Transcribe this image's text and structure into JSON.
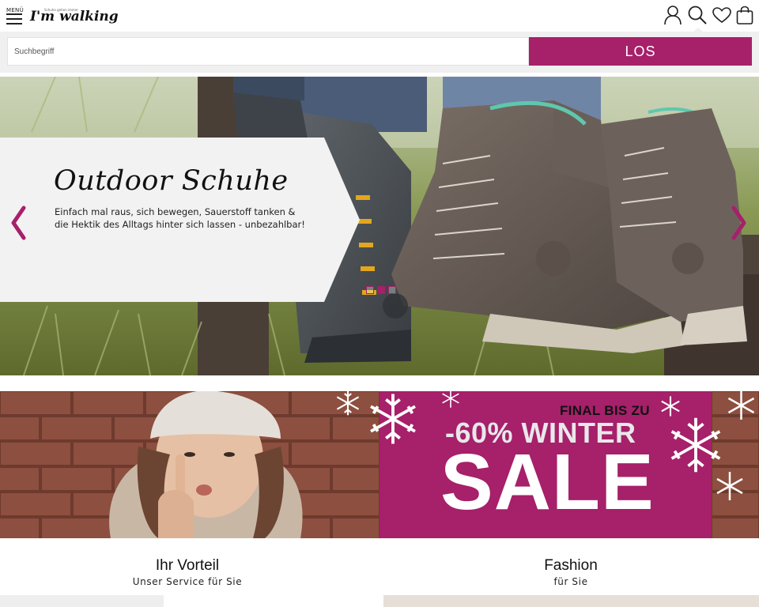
{
  "header": {
    "menu_label": "MENÜ",
    "logo_text": "I'm walking",
    "logo_tagline": "Schuhe gehen immer",
    "icons": [
      "user-icon",
      "search-icon",
      "heart-icon",
      "shopping-bag-icon"
    ]
  },
  "search": {
    "placeholder": "Suchbegriff",
    "button_label": "LOS"
  },
  "hero": {
    "title": "Outdoor Schuhe",
    "text": "Einfach mal raus, sich bewegen, Sauerstoff tanken & die Hektik des Alltags hinter sich lassen - unbezahlbar!",
    "prev_icon": "chevron-left-icon",
    "next_icon": "chevron-right-icon",
    "slides_count": 3,
    "active_slide": 2
  },
  "sale_banner": {
    "line1": "FINAL BIS ZU",
    "line2": "-60% WINTER",
    "line3": "SALE"
  },
  "sections": [
    {
      "title": "Ihr Vorteil",
      "subtitle": "Unser Service für Sie"
    },
    {
      "title": "Fashion",
      "subtitle": "für Sie"
    }
  ],
  "colors": {
    "brand": "#a6206a",
    "search_bg": "#f0f0f0",
    "panel": "#f2f2f2"
  }
}
